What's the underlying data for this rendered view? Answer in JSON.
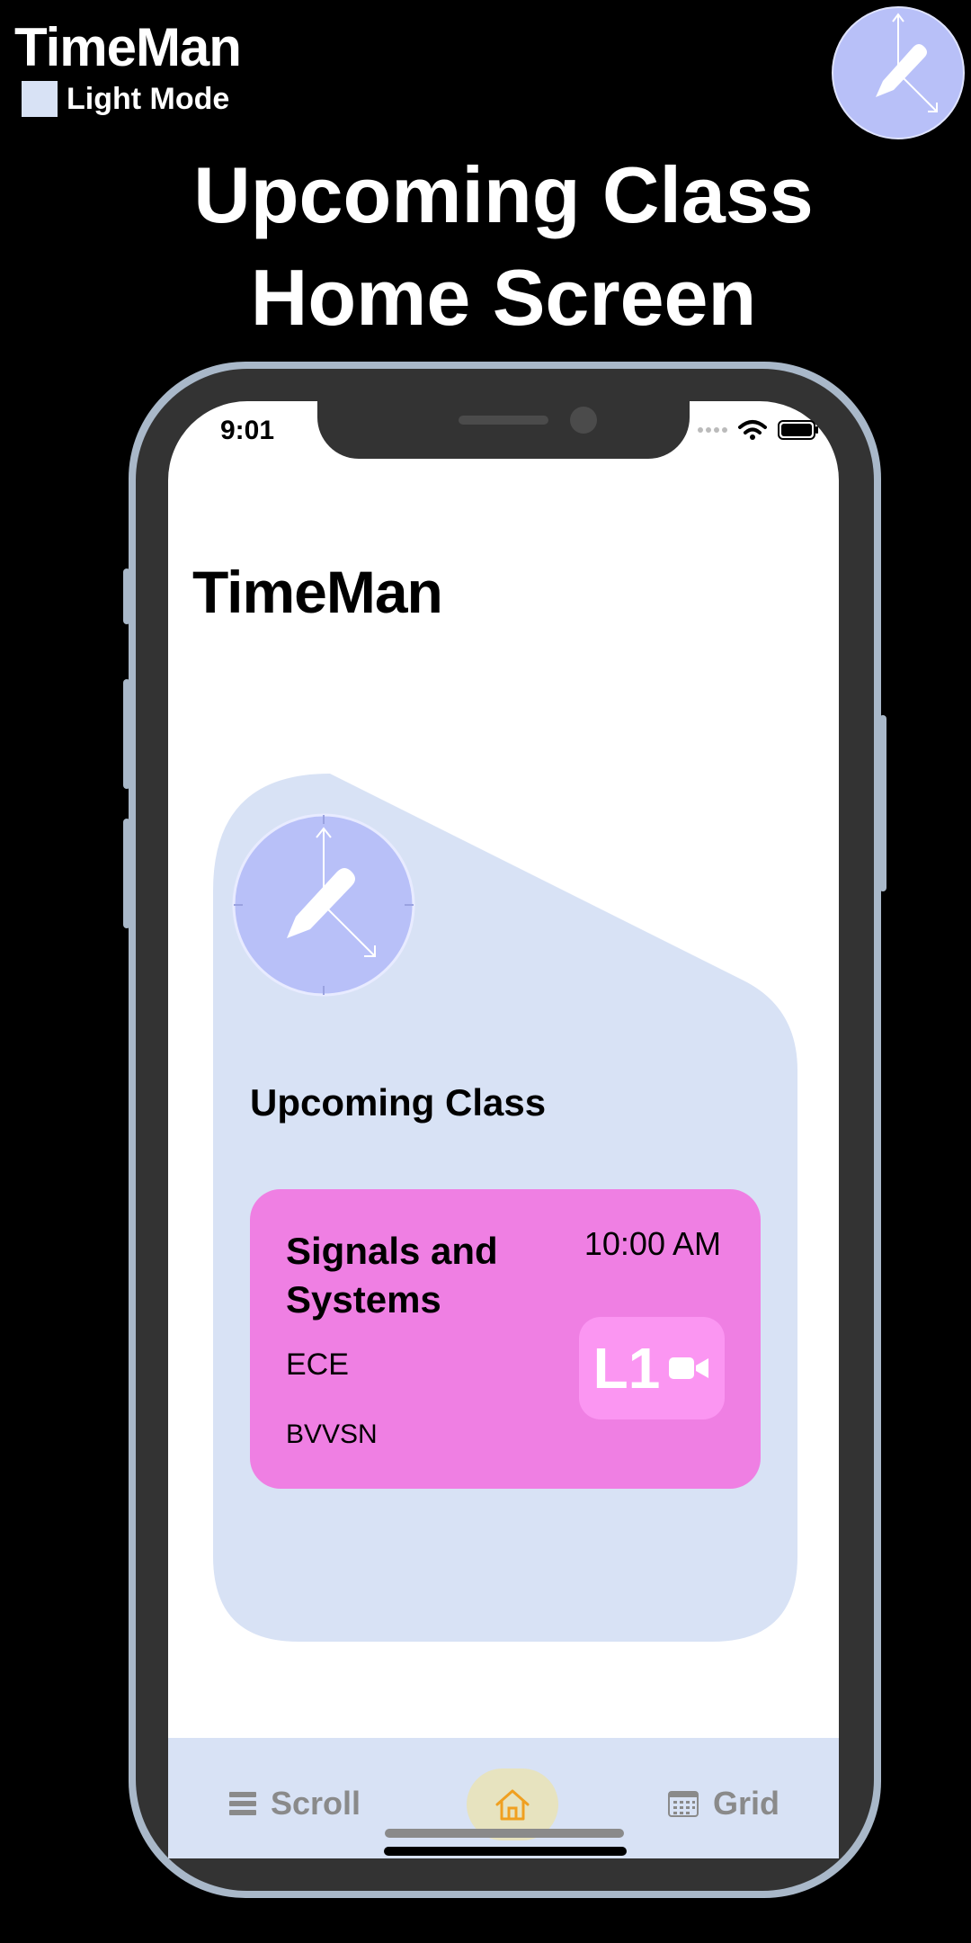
{
  "header": {
    "brand": "TimeMan",
    "mode_label": "Light Mode",
    "headline_line1": "Upcoming Class",
    "headline_line2": "Home Screen"
  },
  "status_bar": {
    "time": "9:01"
  },
  "app": {
    "title": "TimeMan"
  },
  "upcoming": {
    "label": "Upcoming Class",
    "class": {
      "name": "Signals and Systems",
      "time": "10:00 AM",
      "department": "ECE",
      "professor": "BVVSN",
      "room": "L1"
    }
  },
  "nav": {
    "scroll": "Scroll",
    "grid": "Grid"
  },
  "icons": {
    "logo": "clock-pencil-icon",
    "video": "video-camera-icon",
    "home": "home-icon",
    "scroll": "list-icon",
    "grid": "calendar-grid-icon"
  },
  "colors": {
    "background": "#000000",
    "card_background": "#d8e2f5",
    "logo_circle": "#b8c0f8",
    "class_card": "#ef7fe3",
    "room_badge": "#fb96f2",
    "home_accent": "#f0a020",
    "home_bg": "#e7e3bf"
  }
}
